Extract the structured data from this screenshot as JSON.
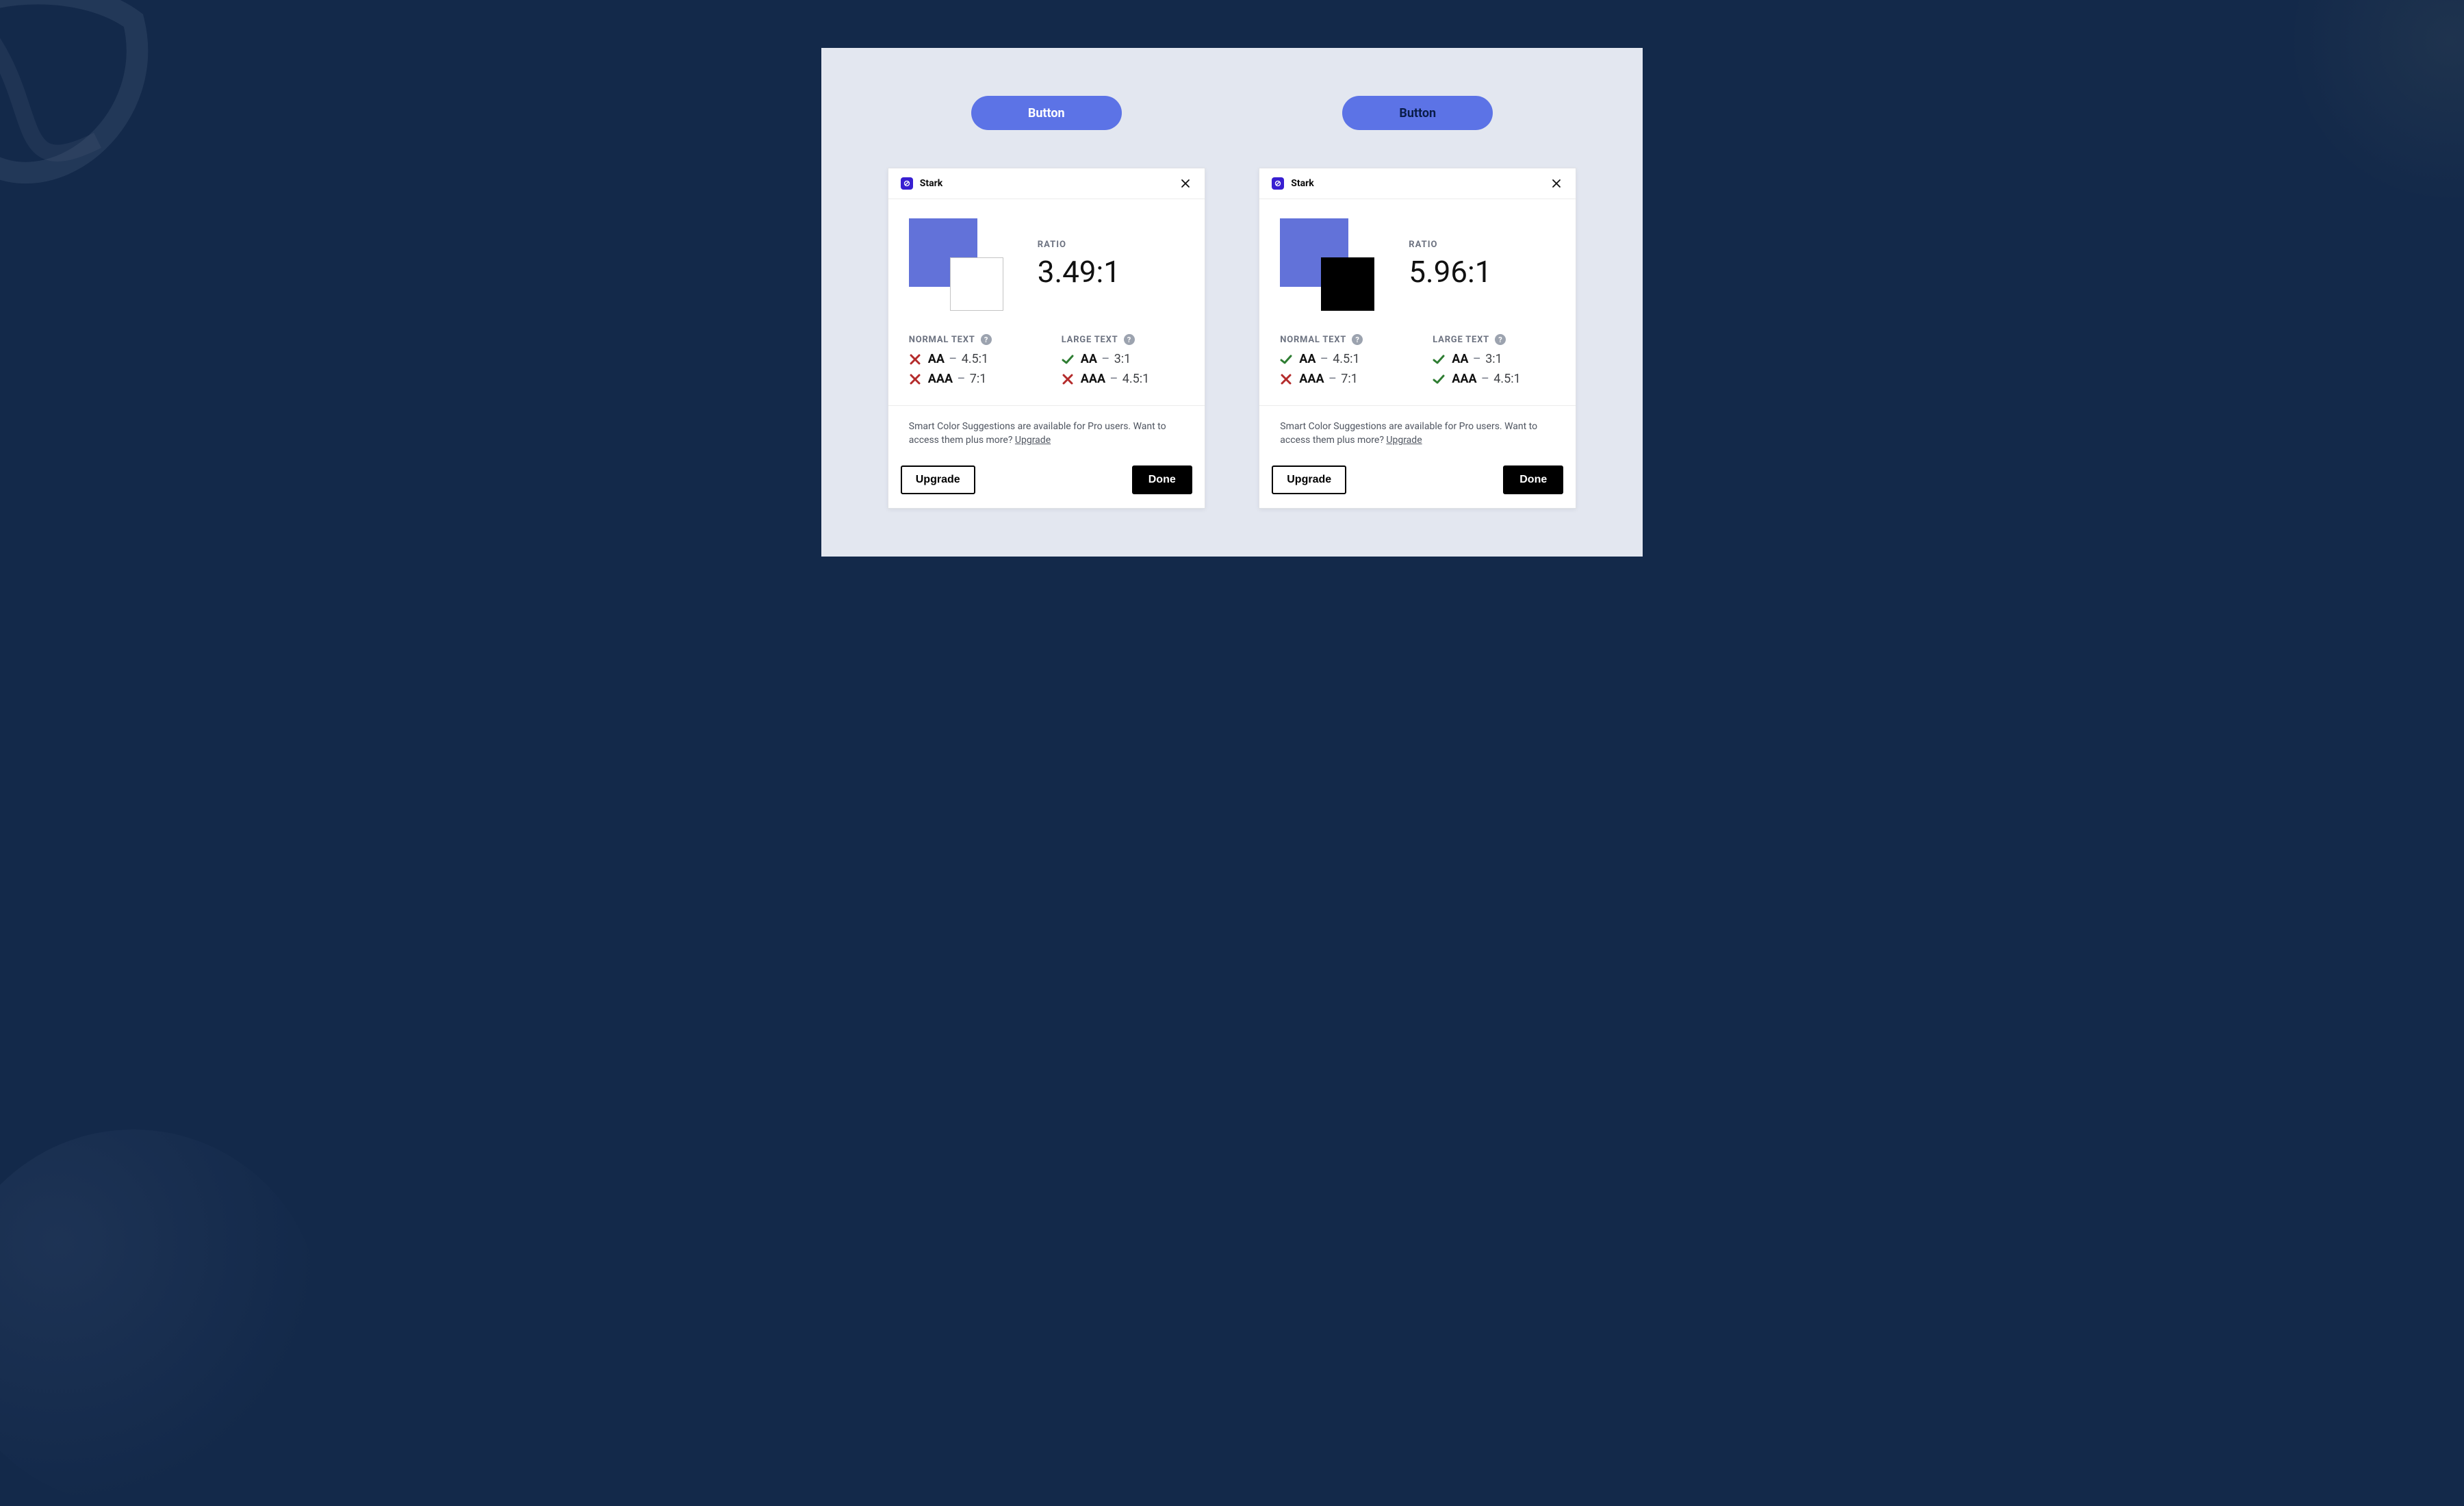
{
  "colors": {
    "button_bg": "#5c73e6",
    "canvas_bg": "#e3e7f0",
    "page_bg": "#13294a"
  },
  "buttons": {
    "left_label": "Button",
    "right_label": "Button"
  },
  "panel": {
    "brand": "Stark"
  },
  "shared": {
    "ratio_label": "RATIO",
    "normal_text_label": "NORMAL TEXT",
    "large_text_label": "LARGE TEXT",
    "upsell_text": "Smart Color Suggestions are available for Pro users. Want to access them plus more? ",
    "upgrade_link": "Upgrade",
    "upgrade_button": "Upgrade",
    "done_button": "Done"
  },
  "left": {
    "ratio": "3.49:1",
    "swatch_bg": "#6272d9",
    "swatch_fg": "#ffffff",
    "normal": [
      {
        "pass": false,
        "level": "AA",
        "req": "4.5:1"
      },
      {
        "pass": false,
        "level": "AAA",
        "req": "7:1"
      }
    ],
    "large": [
      {
        "pass": true,
        "level": "AA",
        "req": "3:1"
      },
      {
        "pass": false,
        "level": "AAA",
        "req": "4.5:1"
      }
    ]
  },
  "right": {
    "ratio": "5.96:1",
    "swatch_bg": "#6272d9",
    "swatch_fg": "#000000",
    "normal": [
      {
        "pass": true,
        "level": "AA",
        "req": "4.5:1"
      },
      {
        "pass": false,
        "level": "AAA",
        "req": "7:1"
      }
    ],
    "large": [
      {
        "pass": true,
        "level": "AA",
        "req": "3:1"
      },
      {
        "pass": true,
        "level": "AAA",
        "req": "4.5:1"
      }
    ]
  }
}
